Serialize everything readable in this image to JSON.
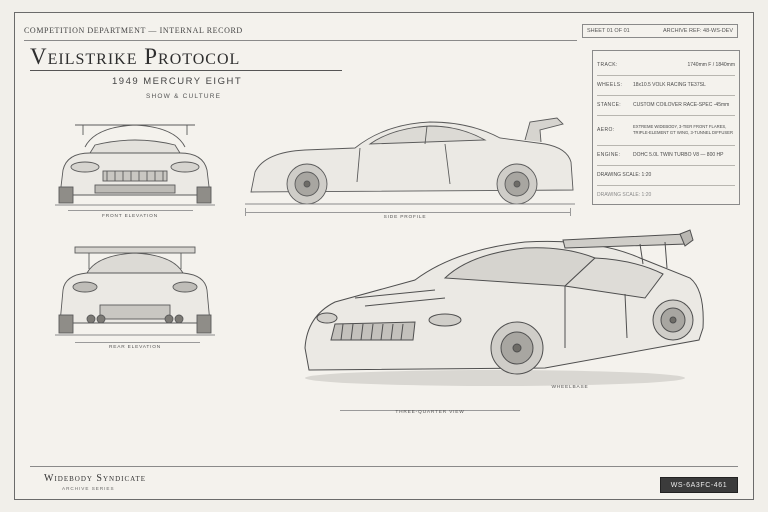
{
  "header": {
    "record_line": "COMPETITION DEPARTMENT — INTERNAL RECORD",
    "sheet": "SHEET 01 OF 01",
    "archive_ref": "ARCHIVE REF: 48-WS-DEV"
  },
  "title": "Veilstrike Protocol",
  "subtitle": "1949 MERCURY EIGHT",
  "category": "SHOW & CULTURE",
  "specs": [
    {
      "key": "TRACK:",
      "value": "1740mm F / 1840mm"
    },
    {
      "key": "WHEELS:",
      "value": "18x10.5 VOLK RACING TE37SL"
    },
    {
      "key": "STANCE:",
      "value": "CUSTOM COILOVER RACE-SPEC -45mm"
    },
    {
      "key": "AERO:",
      "value": "EXTREME WIDEBODY, 3-TIER FRONT FLARES, TRIPLE-ELEMENT GT WING, 3-TUNNEL DIFFUSER"
    },
    {
      "key": "ENGINE:",
      "value": "DOHC 5.0L TWIN TURBO V8 — 800 HP"
    },
    {
      "key": "",
      "value": "DRAWING SCALE: 1:20"
    },
    {
      "key": "",
      "value": "DRAWING   SCALE:   1:20"
    }
  ],
  "views": {
    "front": "FRONT ELEVATION",
    "side": "SIDE PROFILE",
    "rear": "REAR ELEVATION",
    "three_quarter": "THREE-QUARTER VIEW",
    "wheelbase": "WHEELBASE"
  },
  "footer": {
    "brand": "Widebody Syndicate",
    "series": "ARCHIVE SERIES",
    "id": "WS-6A3FC-461"
  }
}
